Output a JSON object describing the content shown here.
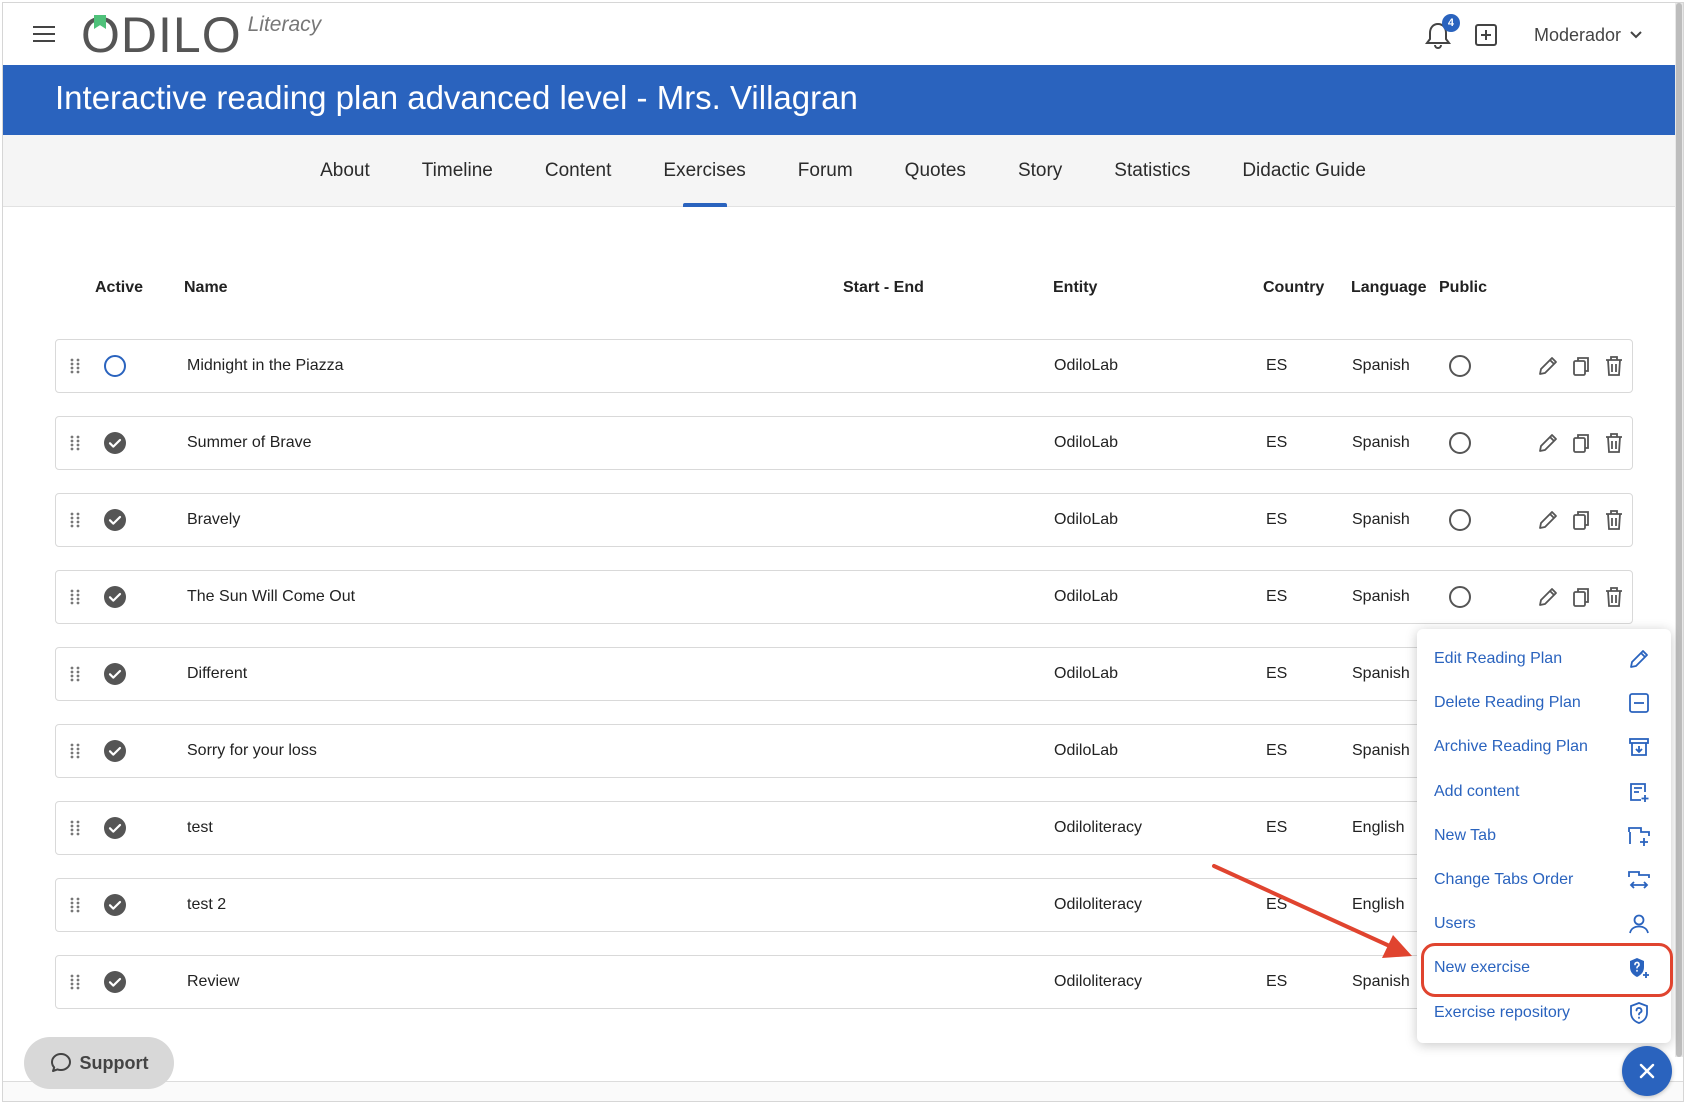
{
  "app": {
    "logo_text": "ODILO",
    "logo_sub": "Literacy"
  },
  "topbar": {
    "notifications_count": "4",
    "user_name": "Moderador"
  },
  "header": {
    "title": "Interactive reading plan advanced level - Mrs. Villagran"
  },
  "tabs": [
    {
      "label": "About"
    },
    {
      "label": "Timeline"
    },
    {
      "label": "Content"
    },
    {
      "label": "Exercises",
      "active": true
    },
    {
      "label": "Forum"
    },
    {
      "label": "Quotes"
    },
    {
      "label": "Story"
    },
    {
      "label": "Statistics"
    },
    {
      "label": "Didactic Guide"
    }
  ],
  "table": {
    "columns": {
      "active": "Active",
      "name": "Name",
      "start_end": "Start - End",
      "entity": "Entity",
      "country": "Country",
      "language": "Language",
      "public": "Public"
    },
    "rows": [
      {
        "name": "Midnight in the Piazza",
        "entity": "OdiloLab",
        "country": "ES",
        "language": "Spanish",
        "active": false
      },
      {
        "name": "Summer of Brave",
        "entity": "OdiloLab",
        "country": "ES",
        "language": "Spanish",
        "active": true
      },
      {
        "name": "Bravely",
        "entity": "OdiloLab",
        "country": "ES",
        "language": "Spanish",
        "active": true
      },
      {
        "name": "The Sun Will Come Out",
        "entity": "OdiloLab",
        "country": "ES",
        "language": "Spanish",
        "active": true
      },
      {
        "name": "Different",
        "entity": "OdiloLab",
        "country": "ES",
        "language": "Spanish",
        "active": true
      },
      {
        "name": "Sorry for your loss",
        "entity": "OdiloLab",
        "country": "ES",
        "language": "Spanish",
        "active": true
      },
      {
        "name": "test",
        "entity": "Odiloliteracy",
        "country": "ES",
        "language": "English",
        "active": true
      },
      {
        "name": "test 2",
        "entity": "Odiloliteracy",
        "country": "ES",
        "language": "English",
        "active": true
      },
      {
        "name": "Review",
        "entity": "Odiloliteracy",
        "country": "ES",
        "language": "Spanish",
        "active": true
      }
    ]
  },
  "menu": {
    "items": [
      {
        "label": "Edit Reading Plan",
        "icon": "pencil-icon"
      },
      {
        "label": "Delete Reading Plan",
        "icon": "minus-square-icon"
      },
      {
        "label": "Archive Reading Plan",
        "icon": "archive-icon"
      },
      {
        "label": "Add content",
        "icon": "add-content-icon"
      },
      {
        "label": "New Tab",
        "icon": "new-tab-icon"
      },
      {
        "label": "Change Tabs Order",
        "icon": "reorder-tabs-icon"
      },
      {
        "label": "Users",
        "icon": "user-icon"
      },
      {
        "label": "New exercise",
        "icon": "new-exercise-icon",
        "highlighted": true
      },
      {
        "label": "Exercise repository",
        "icon": "question-shield-icon"
      }
    ]
  },
  "support": {
    "label": "Support"
  },
  "colors": {
    "brand_blue": "#2a63be",
    "highlight_red": "#e0442f"
  }
}
